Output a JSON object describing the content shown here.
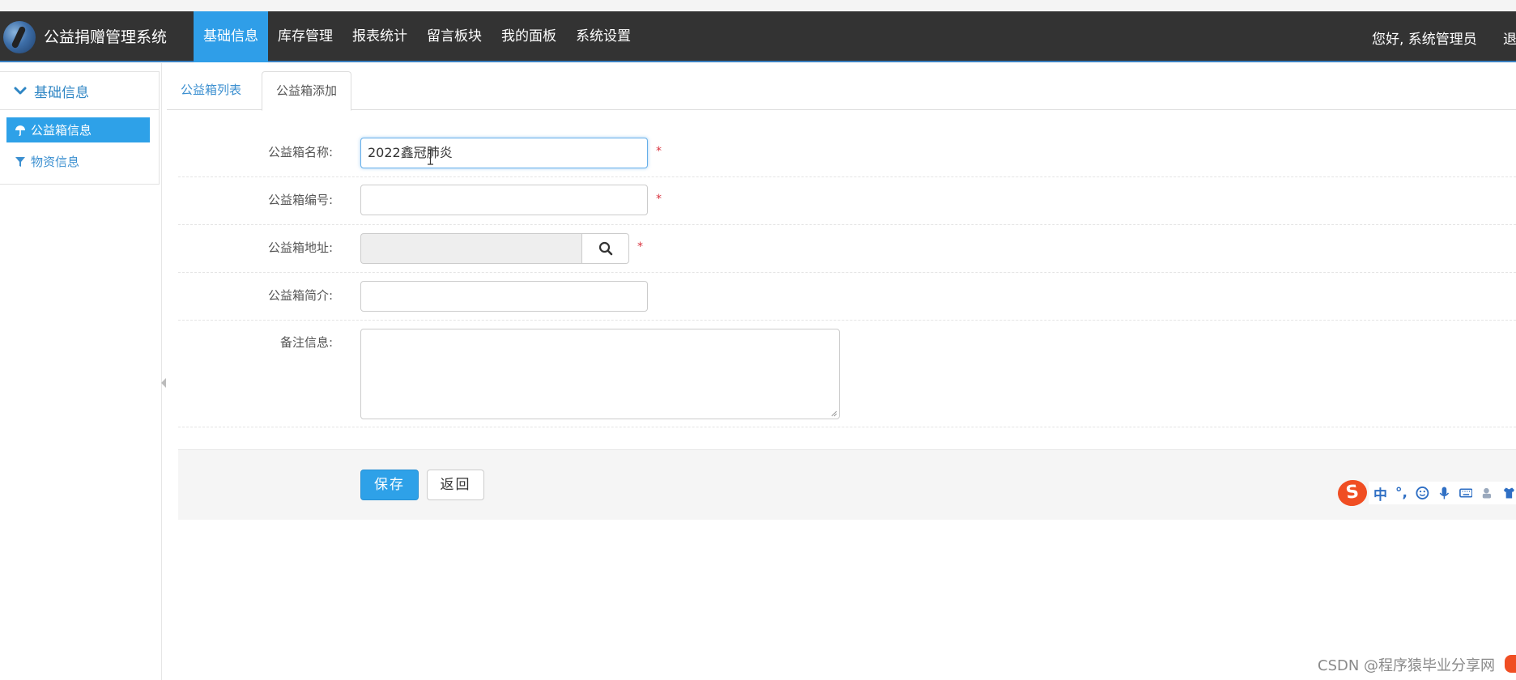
{
  "app": {
    "brand": "公益捐赠管理系统",
    "greeting": "您好, 系统管理员",
    "logout_label": "退出"
  },
  "nav": {
    "items": [
      {
        "label": "基础信息",
        "active": true
      },
      {
        "label": "库存管理",
        "active": false
      },
      {
        "label": "报表统计",
        "active": false
      },
      {
        "label": "留言板块",
        "active": false
      },
      {
        "label": "我的面板",
        "active": false
      },
      {
        "label": "系统设置",
        "active": false
      }
    ]
  },
  "sidebar": {
    "section_title": "基础信息",
    "items": [
      {
        "label": "公益箱信息",
        "icon": "umbrella-icon",
        "active": true
      },
      {
        "label": "物资信息",
        "icon": "filter-icon",
        "active": false
      }
    ]
  },
  "tabs": {
    "list_label": "公益箱列表",
    "add_label": "公益箱添加",
    "active": "公益箱添加"
  },
  "form": {
    "name_label": "公益箱名称:",
    "name_value": "2022鑫冠肺炎",
    "code_label": "公益箱编号:",
    "code_value": "",
    "address_label": "公益箱地址:",
    "address_value": "",
    "intro_label": "公益箱简介:",
    "intro_value": "",
    "remark_label": "备注信息:",
    "remark_value": "",
    "required_mark": "*"
  },
  "actions": {
    "save_label": "保存",
    "back_label": "返回"
  },
  "ime": {
    "mode": "中",
    "punct": "°,"
  },
  "watermark": "CSDN @程序猿毕业分享网",
  "colors": {
    "navbar": "#333333",
    "accent": "#2ea1e8",
    "link": "#3b8fd0",
    "required": "#d9333f"
  }
}
